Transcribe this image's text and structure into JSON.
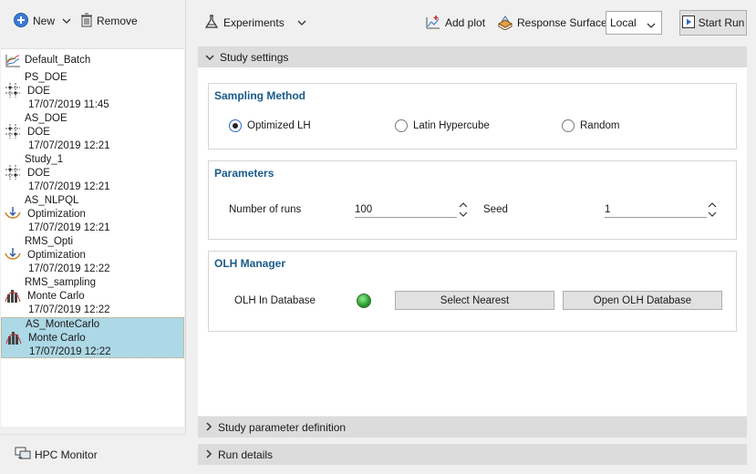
{
  "left_toolbar": {
    "new_label": "New",
    "remove_label": "Remove"
  },
  "studies": [
    {
      "name": "Default_Batch",
      "type": "",
      "date": "",
      "icon": "batch-icon"
    },
    {
      "name": "PS_DOE",
      "type": "DOE",
      "date": "17/07/2019 11:45",
      "icon": "doe-icon"
    },
    {
      "name": "AS_DOE",
      "type": "DOE",
      "date": "17/07/2019 12:21",
      "icon": "doe-icon"
    },
    {
      "name": "Study_1",
      "type": "DOE",
      "date": "17/07/2019 12:21",
      "icon": "doe-icon"
    },
    {
      "name": "AS_NLPQL",
      "type": "Optimization",
      "date": "17/07/2019 12:21",
      "icon": "optimization-icon"
    },
    {
      "name": "RMS_Opti",
      "type": "Optimization",
      "date": "17/07/2019 12:22",
      "icon": "optimization-icon"
    },
    {
      "name": "RMS_sampling",
      "type": "Monte Carlo",
      "date": "17/07/2019 12:22",
      "icon": "monte-carlo-icon"
    },
    {
      "name": "AS_MonteCarlo",
      "type": "Monte Carlo",
      "date": "17/07/2019 12:22",
      "icon": "monte-carlo-icon",
      "selected": true
    }
  ],
  "hpc_monitor_label": "HPC Monitor",
  "right_toolbar": {
    "experiments_label": "Experiments",
    "add_plot_label": "Add plot",
    "response_surface_label": "Response Surface",
    "location_value": "Local",
    "start_run_label": "Start Run"
  },
  "sections": {
    "study_settings": "Study settings",
    "study_parameter_definition": "Study parameter definition",
    "run_details": "Run details"
  },
  "sampling": {
    "title": "Sampling Method",
    "options": [
      "Optimized LH",
      "Latin Hypercube",
      "Random"
    ],
    "selected": "Optimized LH"
  },
  "parameters": {
    "title": "Parameters",
    "runs_label": "Number of runs",
    "runs_value": "100",
    "seed_label": "Seed",
    "seed_value": "1"
  },
  "olh": {
    "title": "OLH Manager",
    "in_db_label": "OLH In Database",
    "status_color": "#2a9a2a",
    "select_nearest_label": "Select Nearest",
    "open_db_label": "Open OLH Database"
  },
  "colors": {
    "accent_title": "#1a5a8a",
    "selected_row": "#add8e6"
  }
}
